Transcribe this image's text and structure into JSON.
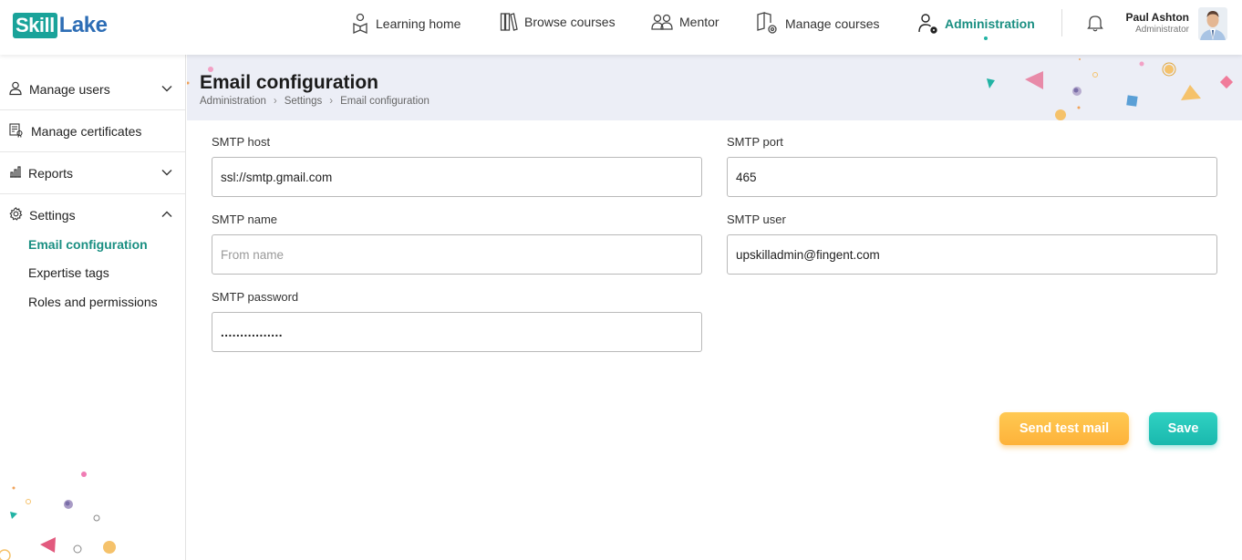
{
  "app": {
    "logo_part1": "Skill",
    "logo_part2": "Lake"
  },
  "topnav": {
    "items": [
      {
        "label": "Learning home",
        "icon": "learning-home-icon"
      },
      {
        "label": "Browse courses",
        "icon": "books-icon"
      },
      {
        "label": "Mentor",
        "icon": "mentor-icon"
      },
      {
        "label": "Manage courses",
        "icon": "manage-courses-icon"
      },
      {
        "label": "Administration",
        "icon": "admin-user-gear-icon",
        "active": true
      }
    ]
  },
  "user": {
    "name": "Paul Ashton",
    "role": "Administrator"
  },
  "sidebar": {
    "items": [
      {
        "label": "Manage users",
        "icon": "user-icon",
        "expanded": false
      },
      {
        "label": "Manage certificates",
        "icon": "certificate-icon"
      },
      {
        "label": "Reports",
        "icon": "chart-icon",
        "expanded": false
      },
      {
        "label": "Settings",
        "icon": "gear-icon",
        "expanded": true
      }
    ],
    "settings_children": [
      {
        "label": "Email configuration",
        "active": true
      },
      {
        "label": "Expertise tags"
      },
      {
        "label": "Roles and permissions"
      }
    ]
  },
  "page": {
    "title": "Email configuration",
    "breadcrumb": [
      "Administration",
      "Settings",
      "Email configuration"
    ]
  },
  "form": {
    "smtp_host": {
      "label": "SMTP host",
      "value": "ssl://smtp.gmail.com"
    },
    "smtp_port": {
      "label": "SMTP port",
      "value": "465"
    },
    "smtp_name": {
      "label": "SMTP name",
      "value": "",
      "placeholder": "From name"
    },
    "smtp_user": {
      "label": "SMTP user",
      "value": "upskilladmin@fingent.com"
    },
    "smtp_password": {
      "label": "SMTP password",
      "value": "................"
    }
  },
  "actions": {
    "send_test_mail": "Send test mail",
    "save": "Save"
  },
  "colors": {
    "brand_teal": "#1aa39a",
    "brand_blue": "#2d6db5",
    "accent_orange": "#fdb23a",
    "accent_teal": "#1ab8ad"
  }
}
